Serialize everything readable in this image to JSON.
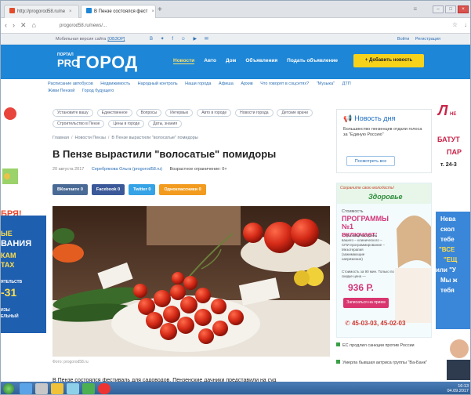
{
  "browser": {
    "tabs": [
      {
        "label": "http://progorod58.ru/ne",
        "fav_color": "#e54b2a",
        "active": false
      },
      {
        "label": "В Пензе состоялся фест",
        "fav_color": "#1d86d6",
        "active": true
      }
    ],
    "new_tab": "+",
    "url": "progorod58.ru/news/...",
    "nav": {
      "back": "‹",
      "forward": "›",
      "reload": "✕"
    }
  },
  "site_top": {
    "left_text": "Мобильная версия сайта",
    "badge": "[ОБЗОР]",
    "icons": "В ✦ f ☺ ▶ ✉",
    "login": "Войти",
    "register": "Регистрация"
  },
  "header": {
    "logo_small": "ПОРТАЛ",
    "logo_pro": "PRO",
    "logo_big": "ГОРОД",
    "nav": [
      "Новости",
      "Авто",
      "Дом",
      "Объявления",
      "Подать объявление"
    ],
    "add_news": "+ Добавить новость"
  },
  "subnav": [
    "Расписание автобусов",
    "Недвижимость",
    "Народный контроль",
    "Наши города",
    "Афиша",
    "Архив",
    "Что говорят в соцсетях?",
    "\"Музыка\"",
    "ДТП",
    "Живи Пензой",
    "Город будущего"
  ],
  "tags": [
    "Установите вашу",
    "Единственное",
    "Вопросы",
    "Интервью",
    "Авто в городе",
    "Новости города",
    "Детские врачи",
    "Строительство в Пензе",
    "Цены в городе",
    "Даты, знания"
  ],
  "breadcrumbs": [
    "Главная",
    "Новости Пензы",
    "В Пензе вырастили \"волосатые\" помидоры"
  ],
  "article": {
    "title": "В Пензе вырастили \"волосатые\" помидоры",
    "date": "20 августа 2017",
    "author": "Серебрякова Ольга (progorod58.ru)",
    "age_limit": "Возрастное ограничение: 0+",
    "caption": "Фото: progorod58.ru",
    "lead": "В Пензе состоялся фестиваль для садоводов. Пензенские дачники представили на суд"
  },
  "share": [
    {
      "label": "ВКонтакте",
      "count": "0",
      "color": "#4a6a96"
    },
    {
      "label": "Facebook",
      "count": "0",
      "color": "#3b5998"
    },
    {
      "label": "Twitter",
      "count": "0",
      "color": "#36a3e6"
    },
    {
      "label": "Одноклассники",
      "count": "0",
      "color": "#f29b1e"
    }
  ],
  "news_day": {
    "title": "Новость дня",
    "text": "Большинство пензенцев отдали голоса за \"Единую Россию\"",
    "button": "Посмотреть все"
  },
  "ad": {
    "slogan": "Сохраните свою молодость!",
    "brand": "Здоровье",
    "l1": "Стоимость",
    "l2": "ПРОГРАММЫ №1 включает:",
    "l3": "– Туловищный прием вашего – клинического – СПИ программирование – Мезотерапия (зажимающие напряжение)",
    "l4": "Стоимость за 90 мин. Только по скидке цена —",
    "price": "936 Р.",
    "cta": "Записаться на прием",
    "phone": "45-03-03, 45-02-03"
  },
  "mini_news": [
    "ЕС продлил санкции против России",
    "Умерла бывшая актриса группы \"Ва-Банк\""
  ],
  "left_ad": {
    "lines": [
      "БРЯ!",
      "ЫЕ",
      "ВАНИЯ",
      "КАМ",
      "ТАХ",
      "ЯТЕЛЬСТВ",
      "-31",
      "ИЗЫ",
      "ЕЛЬНЫЙ"
    ]
  },
  "right_ad": {
    "lines": [
      "НЕ",
      "БАТУТ",
      "ПАР",
      "т. 24-3",
      "Нева",
      "скол",
      "тебе",
      "\"ВСЕ",
      "\"ЕЩ",
      "или \"У",
      "Мы ж",
      "тебя"
    ]
  },
  "tray": {
    "line1": "16:13",
    "line2": "04.09.2017"
  }
}
